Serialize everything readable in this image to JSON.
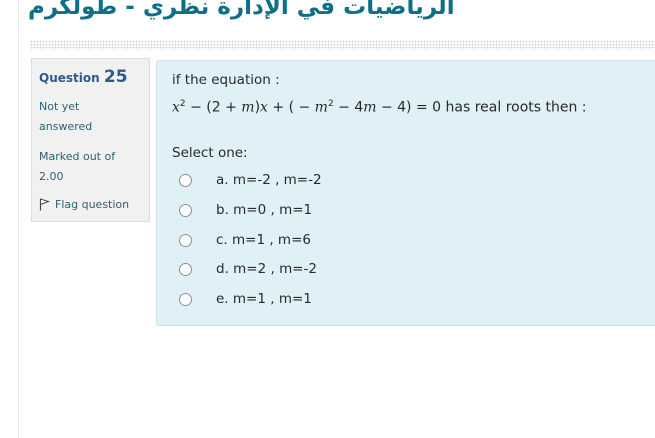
{
  "page": {
    "course_title": "الرياضيات في الإدارة نظري - طولكرم"
  },
  "info": {
    "question_label": "Question",
    "question_number": "25",
    "state_line1": "Not yet",
    "state_line2": "answered",
    "grade_line1": "Marked out of",
    "grade_line2": "2.00",
    "flag_label": "Flag question",
    "flag_icon": "flag-icon"
  },
  "question": {
    "intro": "if the equation :",
    "equation": {
      "x": "x",
      "exp": "2",
      "part_a": " − (2 + ",
      "m1": "m",
      "part_b": ")",
      "x2": "x",
      "part_c": " + ( − ",
      "m2": "m",
      "exp2": "2",
      "part_d": " − 4",
      "m3": "m",
      "part_e": " − 4) = 0",
      "tail": " has real roots then :"
    },
    "prompt": "Select one:",
    "options": [
      {
        "label": "a. m=-2 , m=-2"
      },
      {
        "label": "b. m=0 , m=1"
      },
      {
        "label": "c. m=1 , m=6"
      },
      {
        "label": "d. m=2 , m=-2"
      },
      {
        "label": "e. m=1 , m=1"
      }
    ]
  },
  "colors": {
    "title": "#0f6f86",
    "formulation_bg": "#dff0f6",
    "info_bg": "#f1f1f1",
    "link": "#2b6177"
  }
}
